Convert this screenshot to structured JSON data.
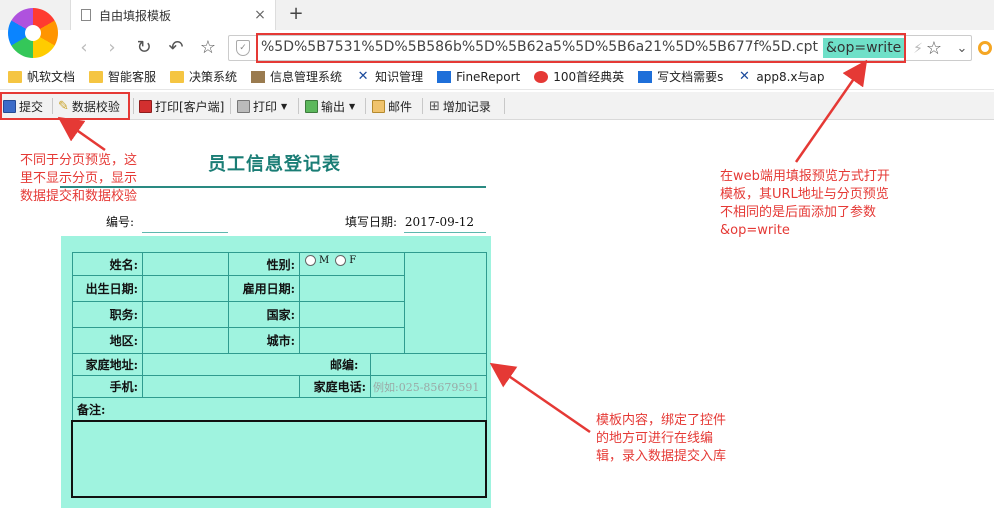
{
  "browser": {
    "tab_title": "自由填报模板",
    "tab_close": "×",
    "new_tab": "+",
    "url_text": "%5D%5B7531%5D%5B586b%5D%5B62a5%5D%5B6a21%5D%5B677f%5D.cpt",
    "url_param": "&op=write",
    "bookmarks": [
      "帆软文档",
      "智能客服",
      "决策系统",
      "信息管理系统",
      "知识管理",
      "FineReport",
      "100首经典英",
      "写文档需要s",
      "app8.x与ap"
    ]
  },
  "toolbar": {
    "submit": "提交",
    "verify": "数据校验",
    "print_client": "打印[客户端]",
    "print": "打印",
    "export": "输出",
    "email": "邮件",
    "add_record": "增加记录"
  },
  "annotations": {
    "left": "不同于分页预览，这\n里不显示分页，显示\n数据提交和数据校验",
    "right_top": "在web端用填报预览方式打开\n模板，其URL地址与分页预览\n不相同的是后面添加了参数\n&op=write",
    "right_bottom": "模板内容，绑定了控件\n的地方可进行在线编\n辑，录入数据提交入库"
  },
  "form": {
    "title": "员工信息登记表",
    "number_label": "编号:",
    "date_label": "填写日期:",
    "date_value": "2017-09-12",
    "name": "姓名:",
    "gender": "性别:",
    "gender_m": "M",
    "gender_f": "F",
    "birth": "出生日期:",
    "hire": "雇用日期:",
    "position": "职务:",
    "country": "国家:",
    "region": "地区:",
    "city": "城市:",
    "address": "家庭地址:",
    "zipcode": "邮编:",
    "mobile": "手机:",
    "home_phone": "家庭电话:",
    "home_phone_placeholder": "例如:025-85679591",
    "remark": "备注:"
  },
  "colors": {
    "form_bg": "#9ff3df",
    "title": "#1a7d75",
    "annotation": "#e53935",
    "url_param_highlight": "#6fe0c8"
  }
}
